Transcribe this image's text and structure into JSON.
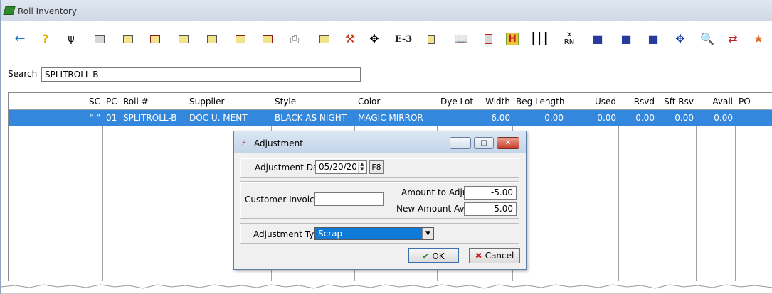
{
  "window": {
    "title": "Roll Inventory"
  },
  "toolbar": {
    "e3_label": "E-3",
    "rn_label": "RN",
    "h_label": "H"
  },
  "search": {
    "label": "Search",
    "value": "SPLITROLL-B"
  },
  "grid": {
    "columns": [
      "SC",
      "PC",
      "Roll #",
      "Supplier",
      "Style",
      "Color",
      "Dye Lot",
      "Width",
      "Beg Length",
      "Used",
      "Rsvd",
      "Sft Rsv",
      "Avail",
      "PO"
    ],
    "rows": [
      [
        "\" \"",
        "01",
        "SPLITROLL-B",
        "DOC U. MENT",
        "BLACK AS NIGHT",
        "MAGIC MIRROR",
        "",
        "6.00",
        "0.00",
        "0.00",
        "0.00",
        "0.00",
        "0.00",
        ""
      ]
    ]
  },
  "dialog": {
    "title": "Adjustment",
    "adjustment_date_label": "Adjustment Date",
    "adjustment_date_value": "05/20/20",
    "f8_label": "F8",
    "customer_invoice_label": "Customer Invoice #",
    "customer_invoice_value": "",
    "amount_to_adjust_label": "Amount to Adjust",
    "amount_to_adjust_value": "-5.00",
    "new_amount_avail_label": "New Amount Avail",
    "new_amount_avail_value": "5.00",
    "adjustment_type_label": "Adjustment Type",
    "adjustment_type_value": "Scrap",
    "ok_label": "OK",
    "cancel_label": "Cancel"
  }
}
